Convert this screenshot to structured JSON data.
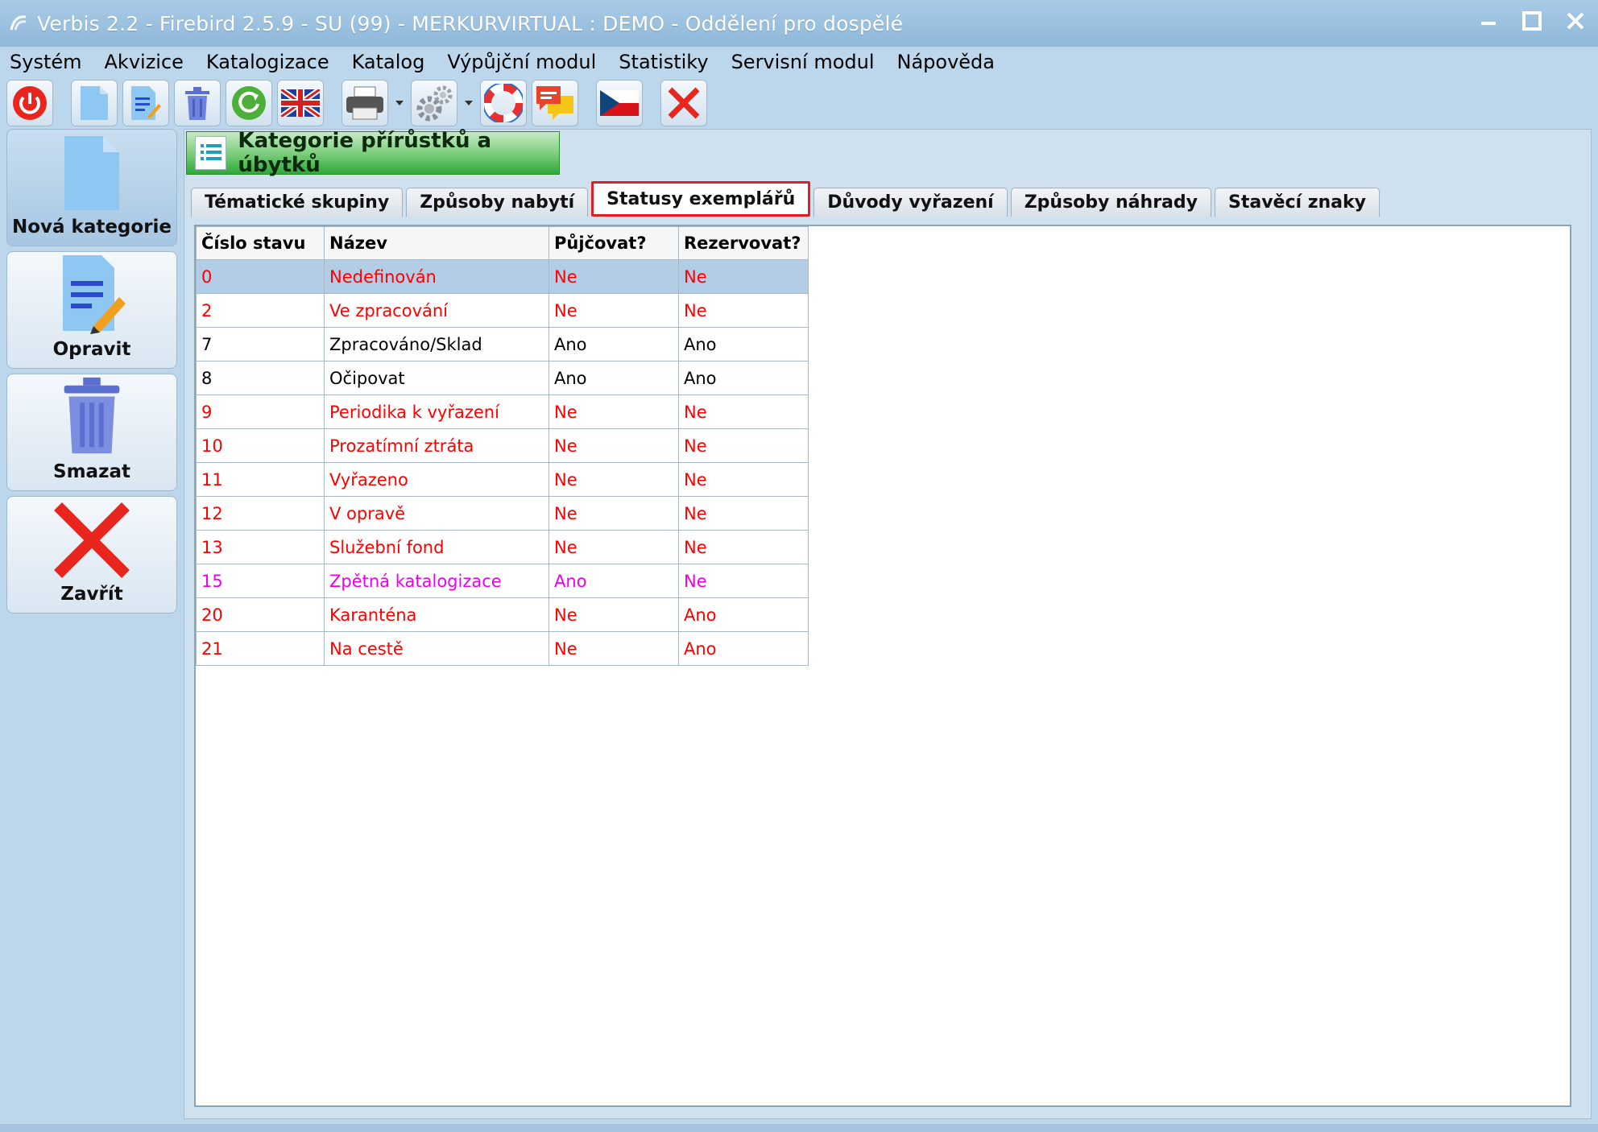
{
  "window": {
    "title": "Verbis 2.2 - Firebird 2.5.9 - SU (99) - MERKURVIRTUAL : DEMO - Oddělení pro dospělé"
  },
  "menu": [
    "Systém",
    "Akvizice",
    "Katalogizace",
    "Katalog",
    "Výpůjční modul",
    "Statistiky",
    "Servisní modul",
    "Nápověda"
  ],
  "sidebar": {
    "new_label": "Nová kategorie",
    "edit_label": "Opravit",
    "delete_label": "Smazat",
    "close_label": "Zavřít"
  },
  "panel": {
    "title": "Kategorie přírůstků a úbytků"
  },
  "tabs": [
    "Tématické skupiny",
    "Způsoby nabytí",
    "Statusy exemplářů",
    "Důvody vyřazení",
    "Způsoby náhrady",
    "Stavěcí znaky"
  ],
  "table": {
    "headers": [
      "Číslo stavu",
      "Název",
      "Půjčovat?",
      "Rezervovat?"
    ],
    "rows": [
      [
        "0",
        "Nedefinován",
        "Ne",
        "Ne"
      ],
      [
        "2",
        "Ve zpracování",
        "Ne",
        "Ne"
      ],
      [
        "7",
        "Zpracováno/Sklad",
        "Ano",
        "Ano"
      ],
      [
        "8",
        "Očipovat",
        "Ano",
        "Ano"
      ],
      [
        "9",
        "Periodika k vyřazení",
        "Ne",
        "Ne"
      ],
      [
        "10",
        "Prozatímní ztráta",
        "Ne",
        "Ne"
      ],
      [
        "11",
        "Vyřazeno",
        "Ne",
        "Ne"
      ],
      [
        "12",
        "V opravě",
        "Ne",
        "Ne"
      ],
      [
        "13",
        "Služební fond",
        "Ne",
        "Ne"
      ],
      [
        "15",
        "Zpětná katalogizace",
        "Ano",
        "Ne"
      ],
      [
        "20",
        "Karanténa",
        "Ne",
        "Ano"
      ],
      [
        "21",
        "Na cestě",
        "Ne",
        "Ano"
      ]
    ]
  },
  "colors": {
    "red_row": "#ff0000",
    "magenta_row": "#ee00ee",
    "selected_row": "#b4cde6",
    "active_tab_border": "#e02020"
  }
}
